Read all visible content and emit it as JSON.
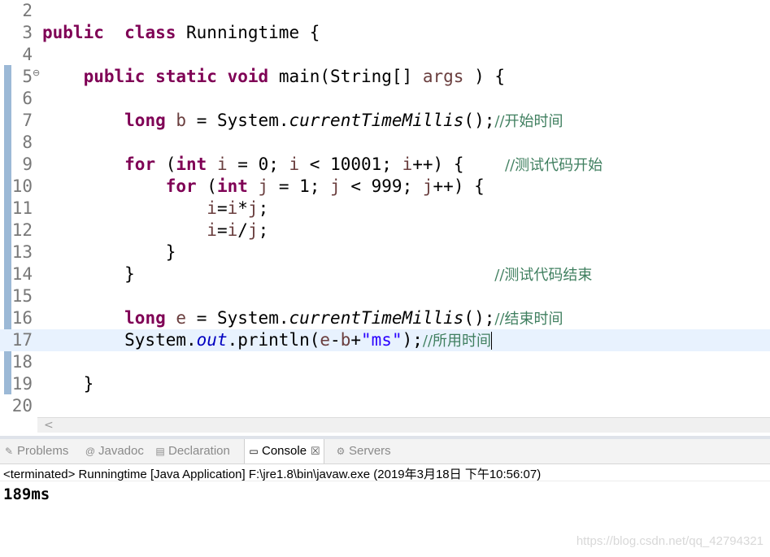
{
  "editor": {
    "current_line": 17,
    "lines": [
      {
        "n": "2",
        "code": []
      },
      {
        "n": "3",
        "code": [
          [
            "kw",
            "public"
          ],
          [
            "",
            "  "
          ],
          [
            "kw",
            "class"
          ],
          [
            "",
            " Runningtime {"
          ]
        ]
      },
      {
        "n": "4",
        "code": []
      },
      {
        "n": "5",
        "fold": "⊖",
        "code": [
          [
            "",
            "    "
          ],
          [
            "kw",
            "public"
          ],
          [
            "",
            " "
          ],
          [
            "kw",
            "static"
          ],
          [
            "",
            " "
          ],
          [
            "kw",
            "void"
          ],
          [
            "",
            " main(String[] "
          ],
          [
            "id",
            "args"
          ],
          [
            "",
            " ) {"
          ]
        ]
      },
      {
        "n": "6",
        "code": []
      },
      {
        "n": "7",
        "code": [
          [
            "",
            "        "
          ],
          [
            "kw",
            "long"
          ],
          [
            "",
            " "
          ],
          [
            "id",
            "b"
          ],
          [
            "",
            " = System."
          ],
          [
            "st",
            "currentTimeMillis"
          ],
          [
            "",
            "();"
          ],
          [
            "cm",
            "//开始时间"
          ]
        ]
      },
      {
        "n": "8",
        "code": []
      },
      {
        "n": "9",
        "code": [
          [
            "",
            "        "
          ],
          [
            "kw",
            "for"
          ],
          [
            "",
            " ("
          ],
          [
            "kw",
            "int"
          ],
          [
            "",
            " "
          ],
          [
            "id",
            "i"
          ],
          [
            "",
            " = 0; "
          ],
          [
            "id",
            "i"
          ],
          [
            "",
            " < 10001; "
          ],
          [
            "id",
            "i"
          ],
          [
            "",
            "++) {    "
          ],
          [
            "cm",
            "//测试代码开始"
          ]
        ]
      },
      {
        "n": "10",
        "code": [
          [
            "",
            "            "
          ],
          [
            "kw",
            "for"
          ],
          [
            "",
            " ("
          ],
          [
            "kw",
            "int"
          ],
          [
            "",
            " "
          ],
          [
            "id",
            "j"
          ],
          [
            "",
            " = 1; "
          ],
          [
            "id",
            "j"
          ],
          [
            "",
            " < 999; "
          ],
          [
            "id",
            "j"
          ],
          [
            "",
            "++) {"
          ]
        ]
      },
      {
        "n": "11",
        "code": [
          [
            "",
            "                "
          ],
          [
            "id",
            "i"
          ],
          [
            "",
            "="
          ],
          [
            "id",
            "i"
          ],
          [
            "",
            "*"
          ],
          [
            "id",
            "j"
          ],
          [
            "",
            ";"
          ]
        ]
      },
      {
        "n": "12",
        "code": [
          [
            "",
            "                "
          ],
          [
            "id",
            "i"
          ],
          [
            "",
            "="
          ],
          [
            "id",
            "i"
          ],
          [
            "",
            "/"
          ],
          [
            "id",
            "j"
          ],
          [
            "",
            ";"
          ]
        ]
      },
      {
        "n": "13",
        "code": [
          [
            "",
            "            }"
          ]
        ]
      },
      {
        "n": "14",
        "code": [
          [
            "",
            "        }                                   "
          ],
          [
            "cm",
            "//测试代码结束"
          ]
        ]
      },
      {
        "n": "15",
        "code": []
      },
      {
        "n": "16",
        "code": [
          [
            "",
            "        "
          ],
          [
            "kw",
            "long"
          ],
          [
            "",
            " "
          ],
          [
            "id",
            "e"
          ],
          [
            "",
            " = System."
          ],
          [
            "st",
            "currentTimeMillis"
          ],
          [
            "",
            "();"
          ],
          [
            "cm",
            "//结束时间"
          ]
        ]
      },
      {
        "n": "17",
        "code": [
          [
            "",
            "        System."
          ],
          [
            "fld",
            "out"
          ],
          [
            "",
            ".println("
          ],
          [
            "id",
            "e"
          ],
          [
            "",
            "-"
          ],
          [
            "id",
            "b"
          ],
          [
            "",
            "+"
          ],
          [
            "str",
            "\"ms\""
          ],
          [
            "",
            ");"
          ],
          [
            "cm",
            "//所用时间"
          ]
        ],
        "caret": true
      },
      {
        "n": "18",
        "code": []
      },
      {
        "n": "19",
        "code": [
          [
            "",
            "    }"
          ]
        ]
      },
      {
        "n": "20",
        "code": []
      }
    ]
  },
  "scroll": {
    "left_arrow": "<"
  },
  "tabs": [
    {
      "label": "Problems",
      "icon": "problems-icon",
      "glyph": "✎",
      "active": false
    },
    {
      "label": "Javadoc",
      "icon": "javadoc-icon",
      "glyph": "@",
      "active": false
    },
    {
      "label": "Declaration",
      "icon": "declaration-icon",
      "glyph": "▤",
      "active": false
    },
    {
      "label": "Console",
      "icon": "console-icon",
      "glyph": "▭",
      "active": true,
      "close": "☒"
    },
    {
      "label": "Servers",
      "icon": "servers-icon",
      "glyph": "⚙",
      "active": false
    }
  ],
  "console": {
    "header": "<terminated> Runningtime [Java Application] F:\\jre1.8\\bin\\javaw.exe (2019年3月18日 下午10:56:07)",
    "output": "189ms"
  },
  "watermark": "https://blog.csdn.net/qq_42794321",
  "colors": {
    "keyword": "#7f0055",
    "comment": "#3f7f5f",
    "string": "#2a00ff",
    "field": "#0000c0",
    "current_line": "#e8f2fe"
  }
}
